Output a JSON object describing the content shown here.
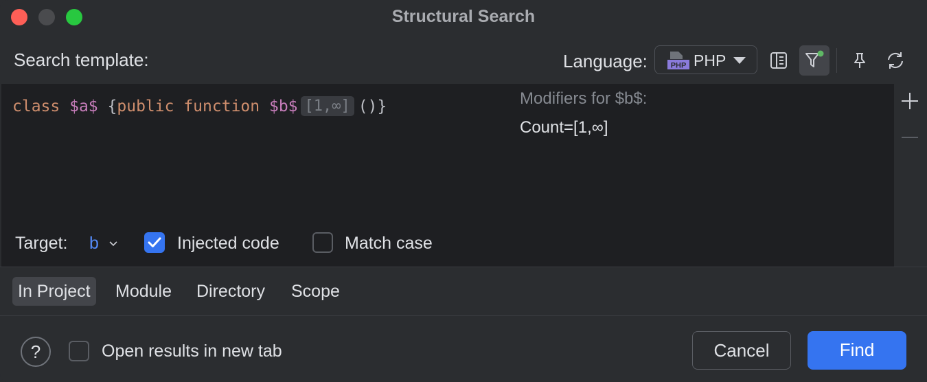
{
  "window": {
    "title": "Structural Search"
  },
  "toolbar": {
    "template_label": "Search template:",
    "language_label": "Language:",
    "language_value": "PHP",
    "language_icon": "php-file-icon"
  },
  "editor": {
    "code": {
      "kw_class": "class",
      "var_a": "$a$",
      "brace_open": "{",
      "kw_public": "public",
      "kw_function": "function",
      "var_b": "$b$",
      "count_chip": "[1,∞]",
      "tail": "()}"
    },
    "modifiers_title": "Modifiers for $b$:",
    "modifiers_value": "Count=[1,∞]"
  },
  "options": {
    "target_label": "Target:",
    "target_value": "b",
    "injected_code_label": "Injected code",
    "injected_code_checked": true,
    "match_case_label": "Match case",
    "match_case_checked": false
  },
  "scope": {
    "tabs": [
      {
        "label": "In Project",
        "active": true
      },
      {
        "label": "Module",
        "active": false
      },
      {
        "label": "Directory",
        "active": false
      },
      {
        "label": "Scope",
        "active": false
      }
    ]
  },
  "footer": {
    "help_symbol": "?",
    "open_new_tab_label": "Open results in new tab",
    "open_new_tab_checked": false,
    "cancel_label": "Cancel",
    "find_label": "Find"
  },
  "colors": {
    "accent": "#3574f0",
    "keyword": "#cf8e6d",
    "variable": "#c77dbb",
    "link": "#548af7"
  }
}
